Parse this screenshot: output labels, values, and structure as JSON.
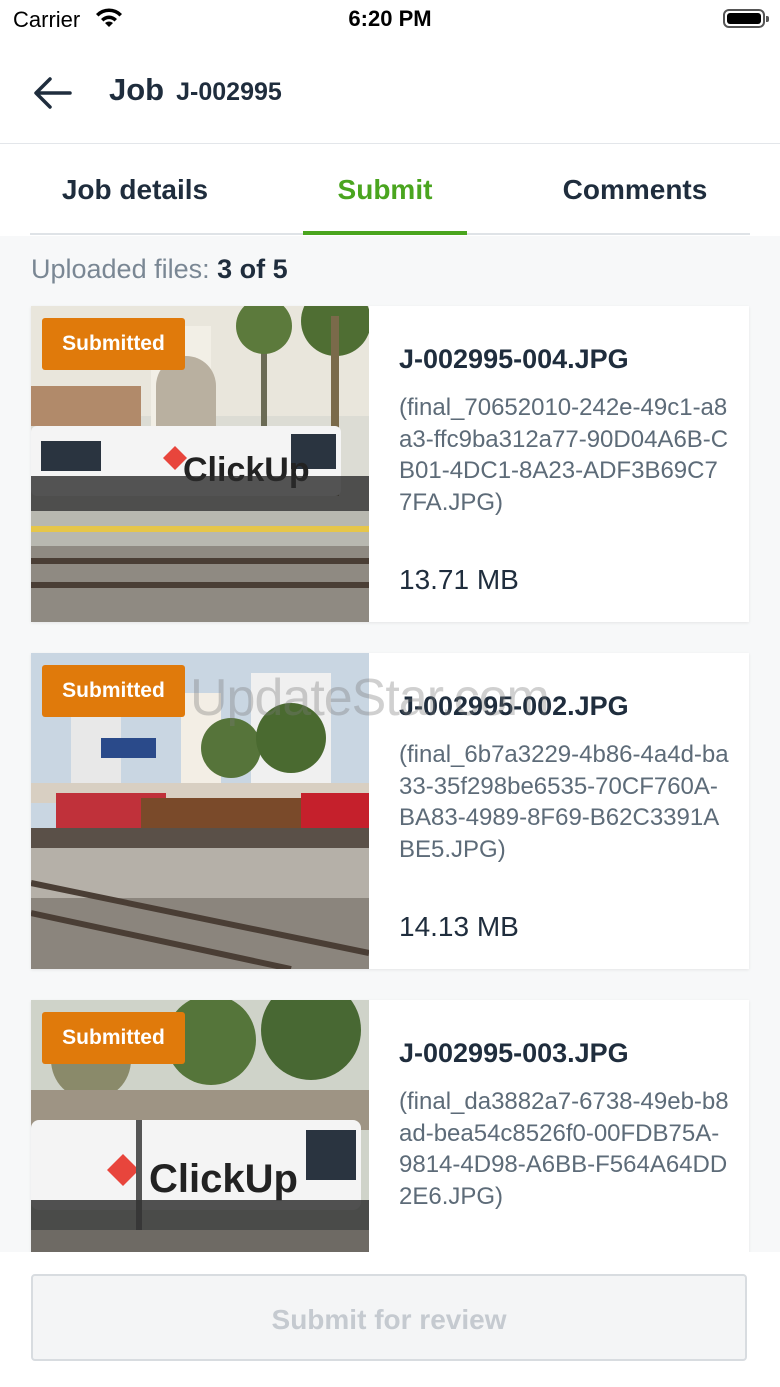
{
  "status_bar": {
    "carrier": "Carrier",
    "time": "6:20 PM"
  },
  "header": {
    "title": "Job",
    "job_code": "J-002995"
  },
  "tabs": [
    {
      "label": "Job details",
      "active": false
    },
    {
      "label": "Submit",
      "active": true
    },
    {
      "label": "Comments",
      "active": false
    }
  ],
  "uploaded": {
    "label": "Uploaded files:",
    "count": "3 of 5"
  },
  "files": [
    {
      "badge": "Submitted",
      "name": "J-002995-004.JPG",
      "original": "(final_70652010-242e-49c1-a8a3-ffc9ba312a77-90D04A6B-CB01-4DC1-8A23-ADF3B69C77FA.JPG)",
      "size": "13.71 MB",
      "thumb_text": "ClickUp"
    },
    {
      "badge": "Submitted",
      "name": "J-002995-002.JPG",
      "original": "(final_6b7a3229-4b86-4a4d-ba33-35f298be6535-70CF760A-BA83-4989-8F69-B62C3391ABE5.JPG)",
      "size": "14.13 MB",
      "thumb_text": ""
    },
    {
      "badge": "Submitted",
      "name": "J-002995-003.JPG",
      "original": "(final_da3882a7-6738-49eb-b8ad-bea54c8526f0-00FDB75A-9814-4D98-A6BB-F564A64DD2E6.JPG)",
      "size": "",
      "thumb_text": "ClickUp"
    }
  ],
  "watermark": "UpdateStar.com",
  "submit_button": {
    "label": "Submit for review",
    "enabled": false
  },
  "colors": {
    "accent": "#4aa51f",
    "badge": "#e07a0b",
    "text": "#1f2d3d"
  }
}
